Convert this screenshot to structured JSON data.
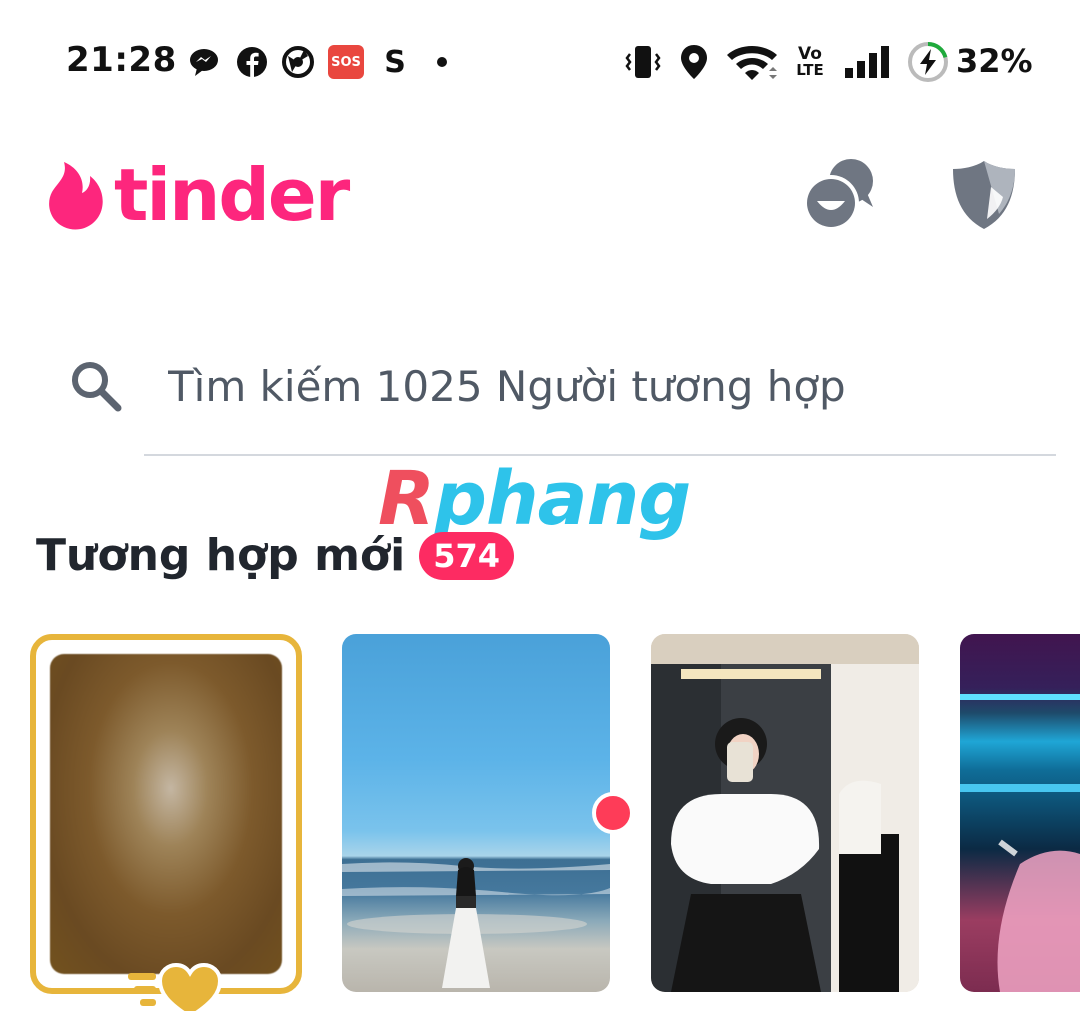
{
  "status_bar": {
    "time": "21:28",
    "notification_icons": [
      "messenger-icon",
      "facebook-icon",
      "browser-icon",
      "sos-icon",
      "s-app-icon",
      "more-dot-icon"
    ],
    "sos_label": "SOS",
    "s_label": "S",
    "system_icons": [
      "vibrate-icon",
      "location-icon",
      "wifi-icon",
      "volte-icon",
      "signal-icon",
      "battery-charging-icon"
    ],
    "volte_top": "Vo",
    "volte_bottom": "LTE",
    "battery_percent": "32%"
  },
  "header": {
    "logo_text": "tinder",
    "brand_color": "#fd267d",
    "buttons": [
      "chat-bubbles-icon",
      "shield-icon"
    ]
  },
  "search": {
    "placeholder": "Tìm kiếm 1025 Người tương hợp"
  },
  "watermark": {
    "first": "R",
    "rest": "phang"
  },
  "new_matches": {
    "title": "Tương hợp mới",
    "count": "574",
    "badge_color": "#fd2b62",
    "cards": [
      {
        "type": "likes-you",
        "blurred": true,
        "frame_color": "#e7b53b"
      },
      {
        "type": "match",
        "scene": "beach",
        "new": true
      },
      {
        "type": "match",
        "scene": "mirror-selfie",
        "new": false
      },
      {
        "type": "match",
        "scene": "neon-room",
        "new": false
      }
    ]
  }
}
